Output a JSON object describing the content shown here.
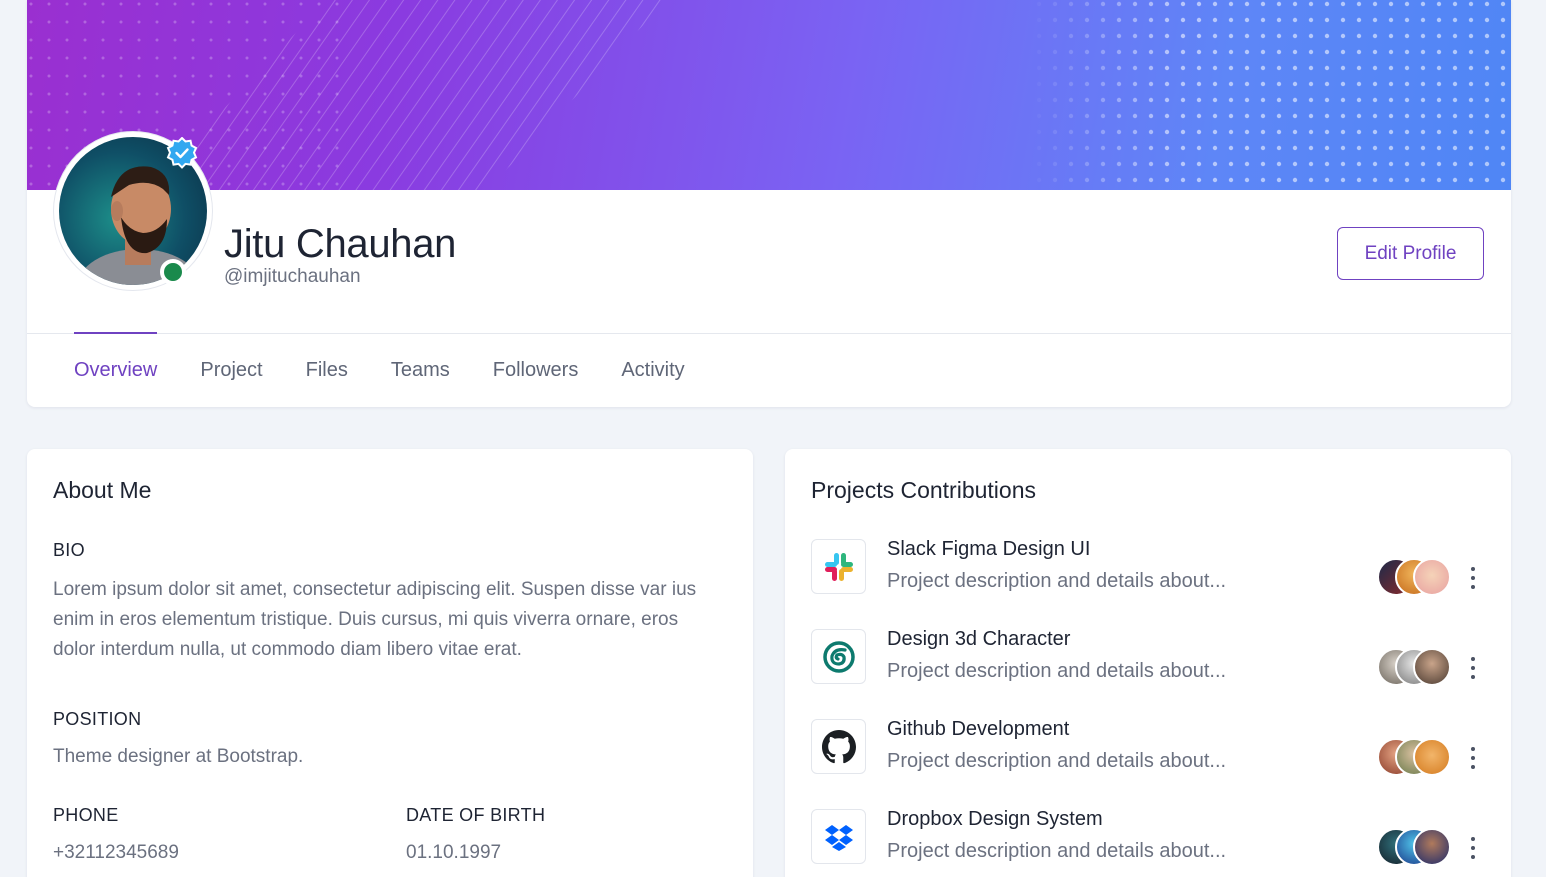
{
  "profile": {
    "name": "Jitu Chauhan",
    "handle": "@imjituchauhan",
    "edit_label": "Edit Profile",
    "accent_color": "#6f42c1",
    "online_status_color": "#1a8a4c"
  },
  "tabs": [
    {
      "label": "Overview",
      "active": true
    },
    {
      "label": "Project",
      "active": false
    },
    {
      "label": "Files",
      "active": false
    },
    {
      "label": "Teams",
      "active": false
    },
    {
      "label": "Followers",
      "active": false
    },
    {
      "label": "Activity",
      "active": false
    }
  ],
  "about": {
    "title": "About Me",
    "bio_label": "BIO",
    "bio": "Lorem ipsum dolor sit amet, consectetur adipiscing elit. Suspen disse var ius enim in eros elementum tristique. Duis cursus, mi quis viverra ornare, eros dolor interdum nulla, ut commodo diam libero vitae erat.",
    "position_label": "POSITION",
    "position": "Theme designer at Bootstrap.",
    "phone_label": "PHONE",
    "phone": "+32112345689",
    "dob_label": "DATE OF BIRTH",
    "dob": "01.10.1997"
  },
  "projects": {
    "title": "Projects Contributions",
    "items": [
      {
        "title": "Slack Figma Design UI",
        "desc": "Project description and details about...",
        "icon": "slack-icon"
      },
      {
        "title": "Design 3d Character",
        "desc": "Project description and details about...",
        "icon": "3d-character-icon"
      },
      {
        "title": "Github Development",
        "desc": "Project description and details about...",
        "icon": "github-icon"
      },
      {
        "title": "Dropbox Design System",
        "desc": "Project description and details about...",
        "icon": "dropbox-icon"
      }
    ]
  }
}
